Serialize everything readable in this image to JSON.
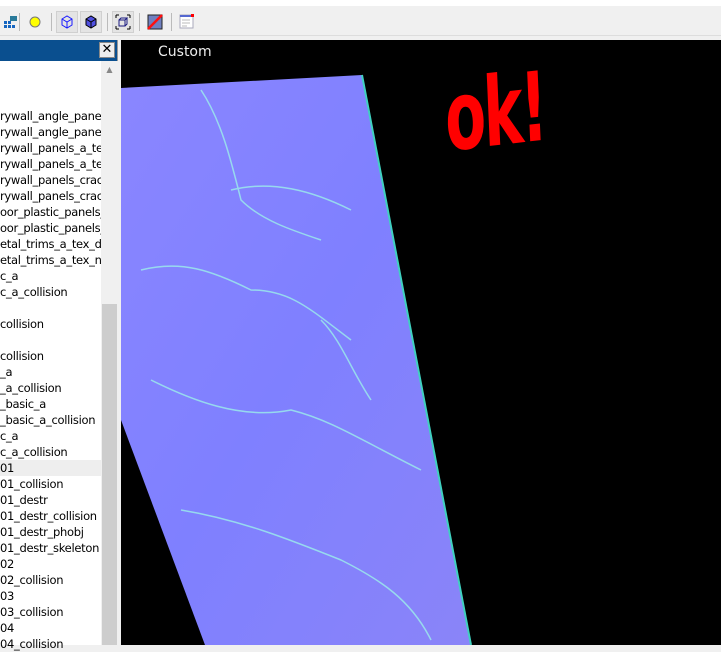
{
  "toolbar": {
    "icons": [
      "camera-grid-icon",
      "light-icon",
      "wireframe-cube-icon",
      "solid-cube-icon",
      "bounding-box-icon",
      "no-texture-icon",
      "text-window-icon"
    ]
  },
  "panel": {
    "close_label": "✕",
    "items": [
      "rywall_angle_panels_",
      "rywall_angle_panels_",
      "rywall_panels_a_tex_",
      "rywall_panels_a_tex_",
      "rywall_panels_crack_",
      "rywall_panels_crack_",
      "oor_plastic_panels_a_",
      "oor_plastic_panels_a_",
      "etal_trims_a_tex_d",
      "etal_trims_a_tex_n",
      "c_a",
      "c_a_collision",
      "",
      "collision",
      "",
      "collision",
      "_a",
      "_a_collision",
      "_basic_a",
      "_basic_a_collision",
      "c_a",
      "c_a_collision",
      "01",
      "01_collision",
      "01_destr",
      "01_destr_collision",
      "01_destr_phobj",
      "01_destr_skeleton",
      "02",
      "02_collision",
      "03",
      "03_collision",
      "04",
      "04_collision"
    ]
  },
  "viewport": {
    "label": "Custom",
    "annotation": "ok!",
    "annotation_color": "#ff0000",
    "surface_color": "#8080ff"
  }
}
